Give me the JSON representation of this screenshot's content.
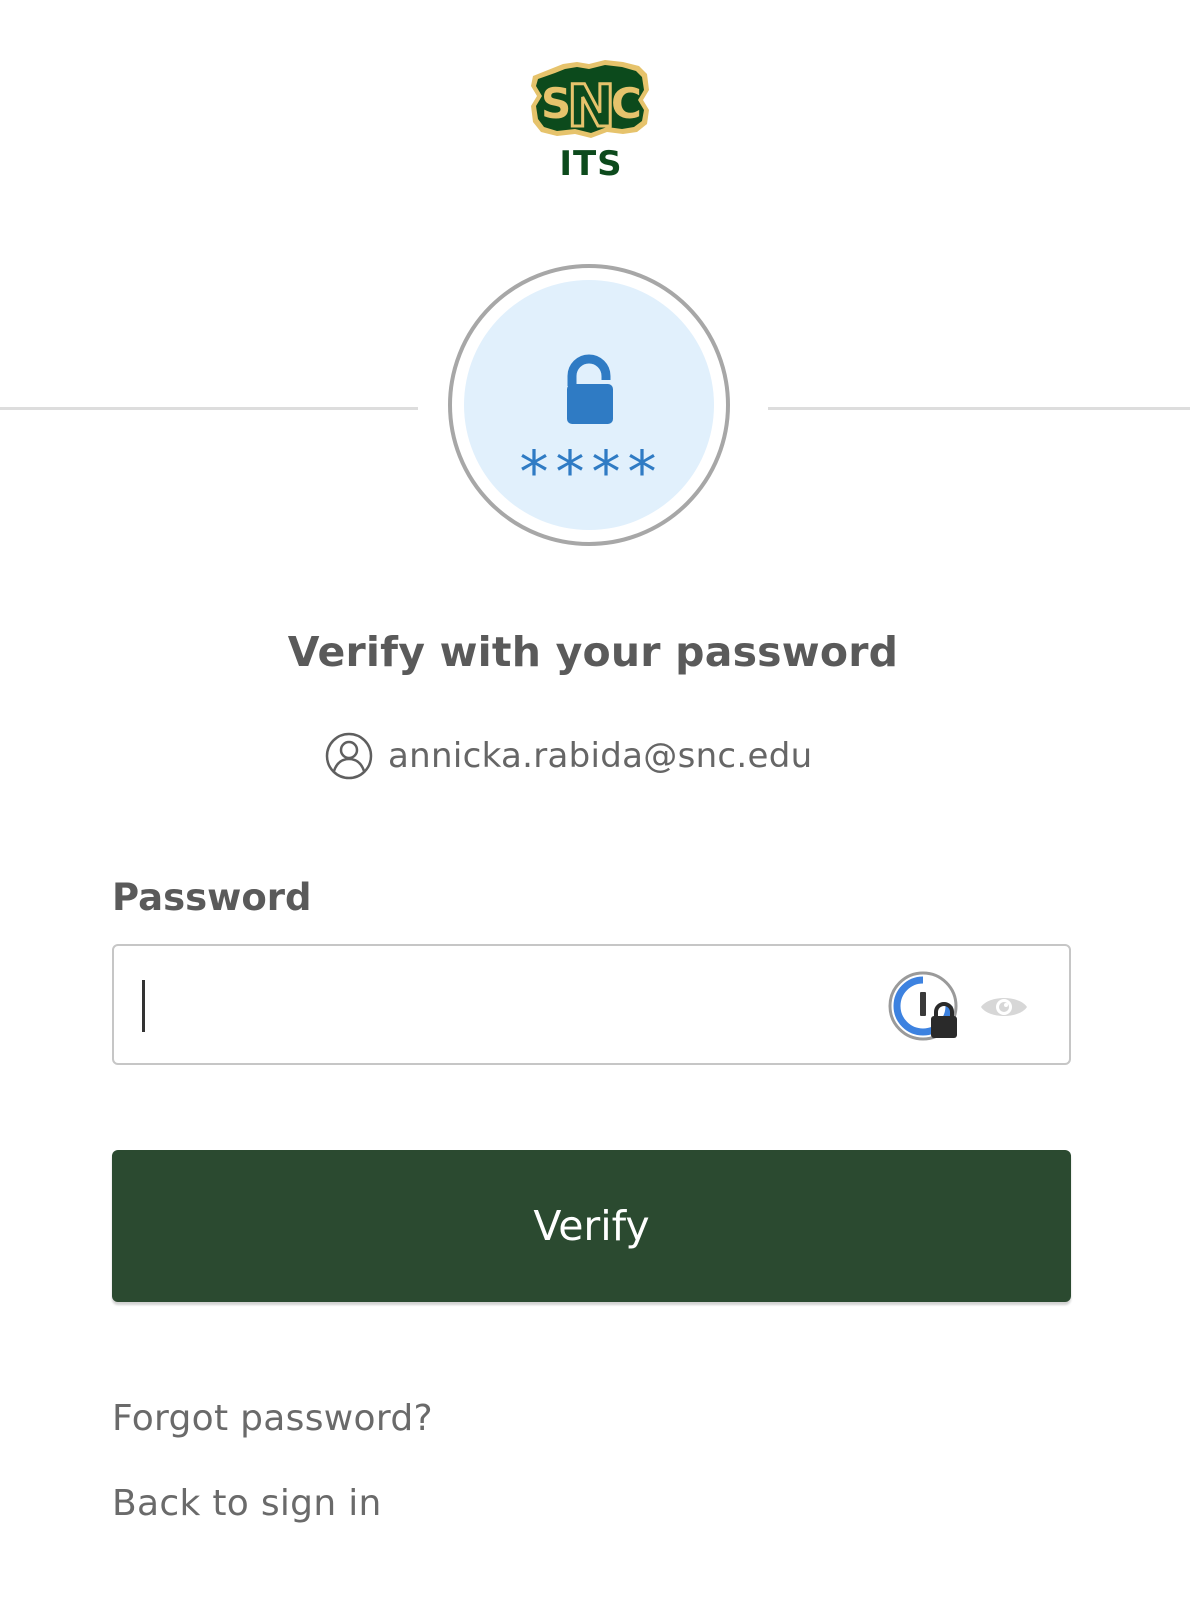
{
  "logo": {
    "letters": "SNC",
    "subtitle": "ITS",
    "colors": {
      "green": "#0c4a1c",
      "gold": "#e6c36c"
    }
  },
  "factor": {
    "icon": "lock-password-icon",
    "masked_text": "****",
    "colors": {
      "icon": "#2f7bc4",
      "background": "#e1f0fc",
      "ring": "#a7a7a7"
    }
  },
  "heading": "Verify with your password",
  "identity": {
    "icon": "user-circle-icon",
    "email": "annicka.rabida@snc.edu"
  },
  "password": {
    "label": "Password",
    "value": "",
    "placeholder": "",
    "password_manager_icon": "password-manager-icon",
    "toggle_icon": "eye-icon"
  },
  "verify_button": {
    "label": "Verify",
    "color": "#2b4a30"
  },
  "links": {
    "forgot": "Forgot password?",
    "back": "Back to sign in"
  }
}
